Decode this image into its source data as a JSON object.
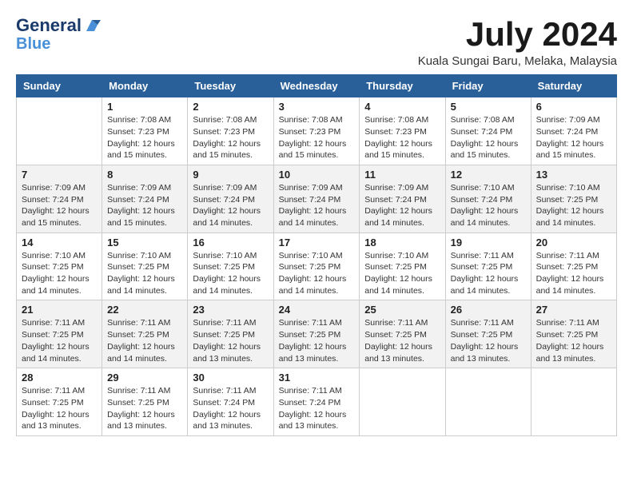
{
  "logo": {
    "line1": "General",
    "line2": "Blue"
  },
  "title": "July 2024",
  "location": "Kuala Sungai Baru, Melaka, Malaysia",
  "headers": [
    "Sunday",
    "Monday",
    "Tuesday",
    "Wednesday",
    "Thursday",
    "Friday",
    "Saturday"
  ],
  "weeks": [
    [
      {
        "day": "",
        "sunrise": "",
        "sunset": "",
        "daylight": ""
      },
      {
        "day": "1",
        "sunrise": "Sunrise: 7:08 AM",
        "sunset": "Sunset: 7:23 PM",
        "daylight": "Daylight: 12 hours and 15 minutes."
      },
      {
        "day": "2",
        "sunrise": "Sunrise: 7:08 AM",
        "sunset": "Sunset: 7:23 PM",
        "daylight": "Daylight: 12 hours and 15 minutes."
      },
      {
        "day": "3",
        "sunrise": "Sunrise: 7:08 AM",
        "sunset": "Sunset: 7:23 PM",
        "daylight": "Daylight: 12 hours and 15 minutes."
      },
      {
        "day": "4",
        "sunrise": "Sunrise: 7:08 AM",
        "sunset": "Sunset: 7:23 PM",
        "daylight": "Daylight: 12 hours and 15 minutes."
      },
      {
        "day": "5",
        "sunrise": "Sunrise: 7:08 AM",
        "sunset": "Sunset: 7:24 PM",
        "daylight": "Daylight: 12 hours and 15 minutes."
      },
      {
        "day": "6",
        "sunrise": "Sunrise: 7:09 AM",
        "sunset": "Sunset: 7:24 PM",
        "daylight": "Daylight: 12 hours and 15 minutes."
      }
    ],
    [
      {
        "day": "7",
        "sunrise": "Sunrise: 7:09 AM",
        "sunset": "Sunset: 7:24 PM",
        "daylight": "Daylight: 12 hours and 15 minutes."
      },
      {
        "day": "8",
        "sunrise": "Sunrise: 7:09 AM",
        "sunset": "Sunset: 7:24 PM",
        "daylight": "Daylight: 12 hours and 15 minutes."
      },
      {
        "day": "9",
        "sunrise": "Sunrise: 7:09 AM",
        "sunset": "Sunset: 7:24 PM",
        "daylight": "Daylight: 12 hours and 14 minutes."
      },
      {
        "day": "10",
        "sunrise": "Sunrise: 7:09 AM",
        "sunset": "Sunset: 7:24 PM",
        "daylight": "Daylight: 12 hours and 14 minutes."
      },
      {
        "day": "11",
        "sunrise": "Sunrise: 7:09 AM",
        "sunset": "Sunset: 7:24 PM",
        "daylight": "Daylight: 12 hours and 14 minutes."
      },
      {
        "day": "12",
        "sunrise": "Sunrise: 7:10 AM",
        "sunset": "Sunset: 7:24 PM",
        "daylight": "Daylight: 12 hours and 14 minutes."
      },
      {
        "day": "13",
        "sunrise": "Sunrise: 7:10 AM",
        "sunset": "Sunset: 7:25 PM",
        "daylight": "Daylight: 12 hours and 14 minutes."
      }
    ],
    [
      {
        "day": "14",
        "sunrise": "Sunrise: 7:10 AM",
        "sunset": "Sunset: 7:25 PM",
        "daylight": "Daylight: 12 hours and 14 minutes."
      },
      {
        "day": "15",
        "sunrise": "Sunrise: 7:10 AM",
        "sunset": "Sunset: 7:25 PM",
        "daylight": "Daylight: 12 hours and 14 minutes."
      },
      {
        "day": "16",
        "sunrise": "Sunrise: 7:10 AM",
        "sunset": "Sunset: 7:25 PM",
        "daylight": "Daylight: 12 hours and 14 minutes."
      },
      {
        "day": "17",
        "sunrise": "Sunrise: 7:10 AM",
        "sunset": "Sunset: 7:25 PM",
        "daylight": "Daylight: 12 hours and 14 minutes."
      },
      {
        "day": "18",
        "sunrise": "Sunrise: 7:10 AM",
        "sunset": "Sunset: 7:25 PM",
        "daylight": "Daylight: 12 hours and 14 minutes."
      },
      {
        "day": "19",
        "sunrise": "Sunrise: 7:11 AM",
        "sunset": "Sunset: 7:25 PM",
        "daylight": "Daylight: 12 hours and 14 minutes."
      },
      {
        "day": "20",
        "sunrise": "Sunrise: 7:11 AM",
        "sunset": "Sunset: 7:25 PM",
        "daylight": "Daylight: 12 hours and 14 minutes."
      }
    ],
    [
      {
        "day": "21",
        "sunrise": "Sunrise: 7:11 AM",
        "sunset": "Sunset: 7:25 PM",
        "daylight": "Daylight: 12 hours and 14 minutes."
      },
      {
        "day": "22",
        "sunrise": "Sunrise: 7:11 AM",
        "sunset": "Sunset: 7:25 PM",
        "daylight": "Daylight: 12 hours and 14 minutes."
      },
      {
        "day": "23",
        "sunrise": "Sunrise: 7:11 AM",
        "sunset": "Sunset: 7:25 PM",
        "daylight": "Daylight: 12 hours and 13 minutes."
      },
      {
        "day": "24",
        "sunrise": "Sunrise: 7:11 AM",
        "sunset": "Sunset: 7:25 PM",
        "daylight": "Daylight: 12 hours and 13 minutes."
      },
      {
        "day": "25",
        "sunrise": "Sunrise: 7:11 AM",
        "sunset": "Sunset: 7:25 PM",
        "daylight": "Daylight: 12 hours and 13 minutes."
      },
      {
        "day": "26",
        "sunrise": "Sunrise: 7:11 AM",
        "sunset": "Sunset: 7:25 PM",
        "daylight": "Daylight: 12 hours and 13 minutes."
      },
      {
        "day": "27",
        "sunrise": "Sunrise: 7:11 AM",
        "sunset": "Sunset: 7:25 PM",
        "daylight": "Daylight: 12 hours and 13 minutes."
      }
    ],
    [
      {
        "day": "28",
        "sunrise": "Sunrise: 7:11 AM",
        "sunset": "Sunset: 7:25 PM",
        "daylight": "Daylight: 12 hours and 13 minutes."
      },
      {
        "day": "29",
        "sunrise": "Sunrise: 7:11 AM",
        "sunset": "Sunset: 7:25 PM",
        "daylight": "Daylight: 12 hours and 13 minutes."
      },
      {
        "day": "30",
        "sunrise": "Sunrise: 7:11 AM",
        "sunset": "Sunset: 7:24 PM",
        "daylight": "Daylight: 12 hours and 13 minutes."
      },
      {
        "day": "31",
        "sunrise": "Sunrise: 7:11 AM",
        "sunset": "Sunset: 7:24 PM",
        "daylight": "Daylight: 12 hours and 13 minutes."
      },
      {
        "day": "",
        "sunrise": "",
        "sunset": "",
        "daylight": ""
      },
      {
        "day": "",
        "sunrise": "",
        "sunset": "",
        "daylight": ""
      },
      {
        "day": "",
        "sunrise": "",
        "sunset": "",
        "daylight": ""
      }
    ]
  ]
}
